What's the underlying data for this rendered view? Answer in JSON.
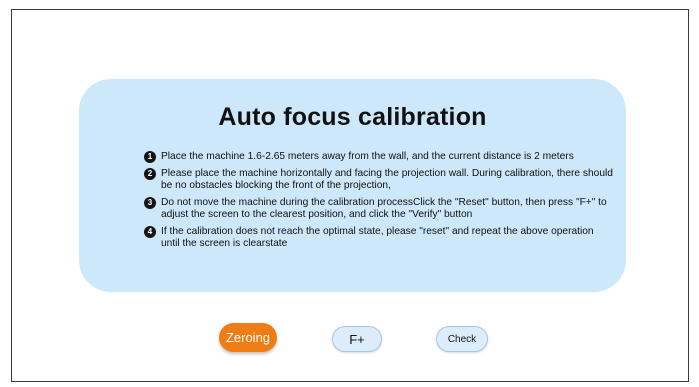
{
  "dialog": {
    "title": "Auto focus calibration",
    "steps": [
      {
        "number": "1",
        "text": "Place the machine 1.6-2.65 meters away from the wall, and the current distance is 2 meters"
      },
      {
        "number": "2",
        "text": "Please place the machine horizontally and facing the projection wall. During calibration, there should be no obstacles blocking the front of the projection,"
      },
      {
        "number": "3",
        "text": "Do not move the machine during the calibration processClick the \"Reset\" button, then press \"F+\" to adjust the screen to the clearest position, and click the \"Verify\" button"
      },
      {
        "number": "4",
        "text": "If the calibration does not reach the optimal state, please \"reset\" and repeat the above operation until the screen is clearstate"
      }
    ]
  },
  "buttons": {
    "zeroing_label": "Zeroing",
    "fplus_label": "F+",
    "check_label": "Check"
  },
  "colors": {
    "card_background": "#cde8fb",
    "zeroing_button": "#ef7d16",
    "secondary_button": "#dcecfb"
  }
}
